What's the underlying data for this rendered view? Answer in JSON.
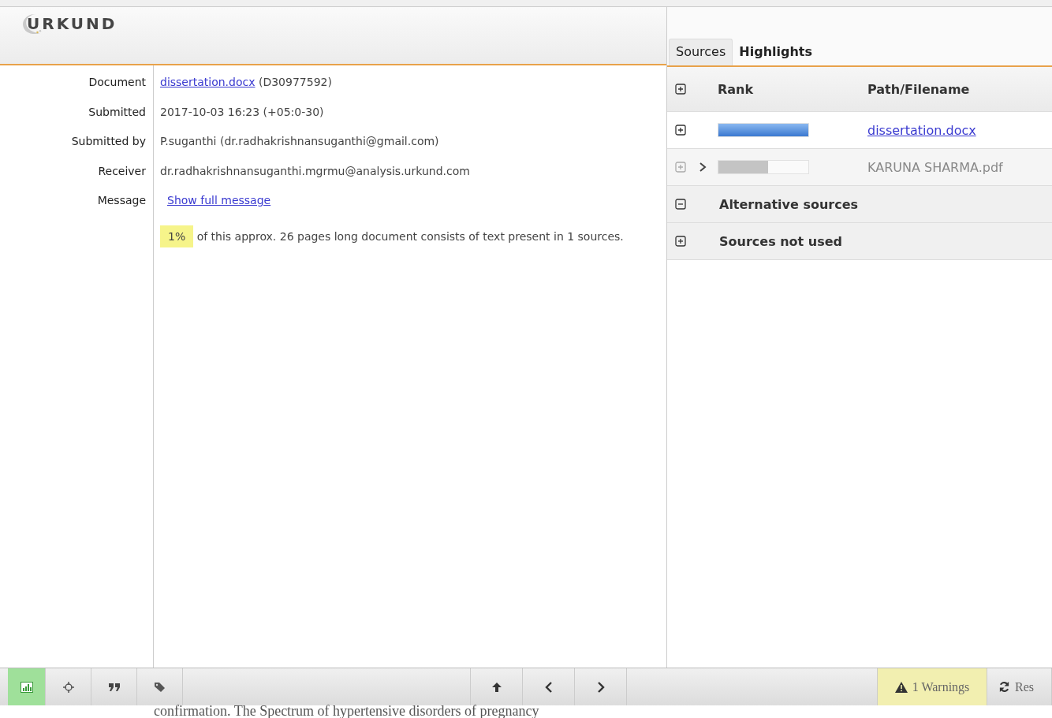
{
  "logo": {
    "text": "URKUND"
  },
  "details": [
    {
      "label": "Document",
      "kind": "document",
      "link": "dissertation.docx",
      "value": "(D30977592)"
    },
    {
      "label": "Submitted",
      "kind": "text",
      "value": "2017-10-03 16:23 (+05:0-30)"
    },
    {
      "label": "Submitted by",
      "kind": "text",
      "value": "P.suganthi (dr.radhakrishnansuganthi@gmail.com)"
    },
    {
      "label": "Receiver",
      "kind": "text",
      "value": "dr.radhakrishnansuganthi.mgrmu@analysis.urkund.com"
    },
    {
      "label": "Message",
      "kind": "link",
      "link": "Show full message"
    }
  ],
  "summary": {
    "percent": "1%",
    "text": "of this approx. 26 pages long document consists of text present in 1 sources."
  },
  "tabs": [
    {
      "label": "Sources",
      "selected": true
    },
    {
      "label": "Highlights",
      "selected": false
    }
  ],
  "table": {
    "columns": [
      "Rank",
      "Path/Filename"
    ],
    "rows": [
      {
        "level": 1.0,
        "active": true,
        "chevron": false,
        "filename": "dissertation.docx"
      },
      {
        "level": 0.55,
        "active": false,
        "chevron": true,
        "filename": "KARUNA SHARMA.pdf"
      }
    ],
    "groups": [
      {
        "label": "Alternative sources",
        "expanded": true
      },
      {
        "label": "Sources not used",
        "expanded": false
      }
    ]
  },
  "toolbar": {
    "left": [
      {
        "kind": "chart",
        "selected": true
      },
      {
        "kind": "crosshair",
        "selected": false
      },
      {
        "kind": "quote",
        "selected": false
      },
      {
        "kind": "tags",
        "selected": false
      }
    ],
    "nav": [
      {
        "kind": "up"
      },
      {
        "kind": "prev"
      },
      {
        "kind": "next"
      }
    ],
    "warnings": "1 Warnings",
    "reset": "Res"
  },
  "footer_text": "confirmation. The Spectrum of hypertensive disorders of pregnancy"
}
